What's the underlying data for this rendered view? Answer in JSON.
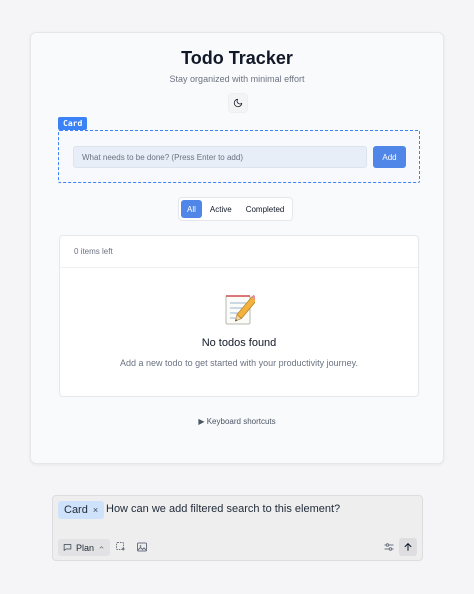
{
  "app": {
    "title": "Todo Tracker",
    "subtitle": "Stay organized with minimal effort",
    "theme_toggle_icon": "moon-icon"
  },
  "card_tag": {
    "label": "Card"
  },
  "input": {
    "placeholder": "What needs to be done? (Press Enter to add)",
    "value": "",
    "add_label": "Add"
  },
  "filters": {
    "items": [
      {
        "label": "All",
        "active": true
      },
      {
        "label": "Active",
        "active": false
      },
      {
        "label": "Completed",
        "active": false
      }
    ]
  },
  "list": {
    "items_left": "0 items left",
    "empty_icon": "memo-icon",
    "empty_title": "No todos found",
    "empty_desc": "Add a new todo to get started with your productivity journey."
  },
  "shortcuts": {
    "label": "Keyboard shortcuts",
    "icon": "triangle-right-icon"
  },
  "chat": {
    "chip_label": "Card",
    "chip_close": "×",
    "message": "How can we add filtered search to this element?",
    "plan_label": "Plan",
    "icons": [
      "chat-icon",
      "chevron-up-icon",
      "select-element-icon",
      "image-icon",
      "sliders-icon",
      "arrow-up-icon"
    ]
  },
  "colors": {
    "accent": "#4f86e8",
    "outline": "#3b82f6",
    "chip_bg": "#cfe2fb"
  }
}
